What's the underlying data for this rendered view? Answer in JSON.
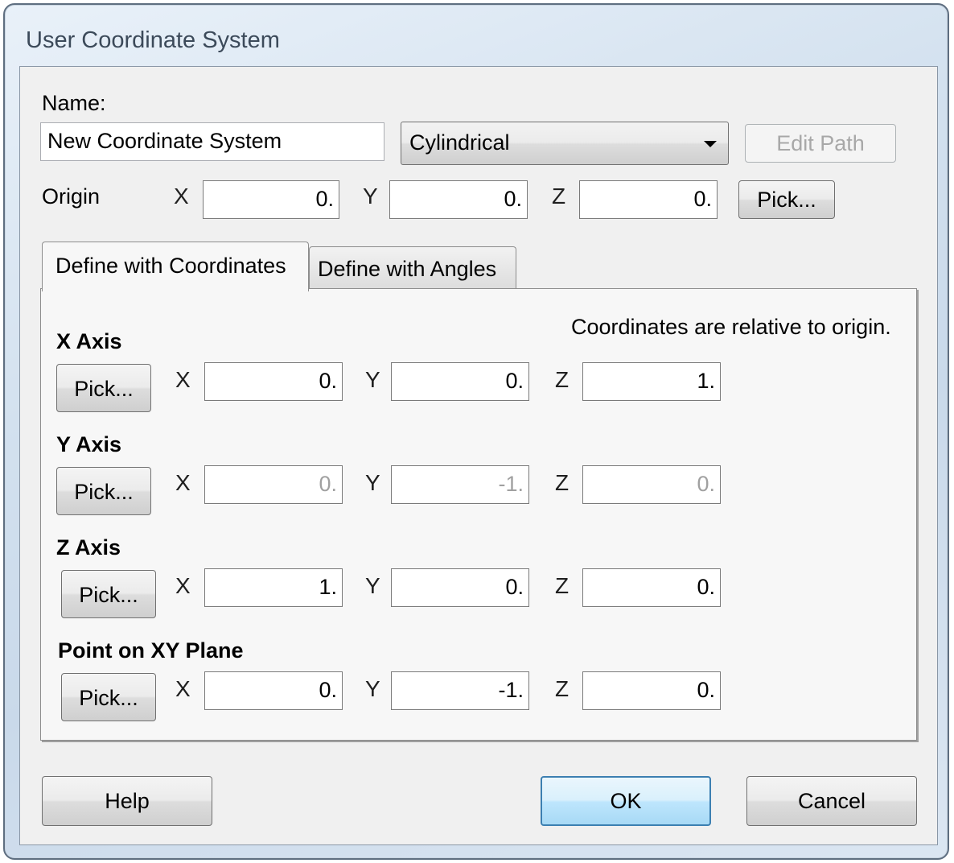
{
  "window": {
    "title": "User Coordinate System"
  },
  "name_section": {
    "label": "Name:",
    "value": "New Coordinate System",
    "type_selected": "Cylindrical",
    "edit_path_label": "Edit Path"
  },
  "origin": {
    "label": "Origin",
    "x": "0.",
    "y": "0.",
    "z": "0.",
    "pick_label": "Pick..."
  },
  "axis_letters": {
    "x": "X",
    "y": "Y",
    "z": "Z"
  },
  "tabs": [
    {
      "label": "Define with Coordinates",
      "selected": true
    },
    {
      "label": "Define with Angles",
      "selected": false
    }
  ],
  "panel": {
    "note": "Coordinates are relative to origin.",
    "rows": [
      {
        "heading": "X Axis",
        "pick_label": "Pick...",
        "x": "0.",
        "y": "0.",
        "z": "1.",
        "enabled": true
      },
      {
        "heading": "Y Axis",
        "pick_label": "Pick...",
        "x": "0.",
        "y": "-1.",
        "z": "0.",
        "enabled": false
      },
      {
        "heading": "Z Axis",
        "pick_label": "Pick...",
        "x": "1.",
        "y": "0.",
        "z": "0.",
        "enabled": true
      },
      {
        "heading": "Point on XY Plane",
        "pick_label": "Pick...",
        "x": "0.",
        "y": "-1.",
        "z": "0.",
        "enabled": true
      }
    ]
  },
  "footer": {
    "help_label": "Help",
    "ok_label": "OK",
    "cancel_label": "Cancel"
  }
}
